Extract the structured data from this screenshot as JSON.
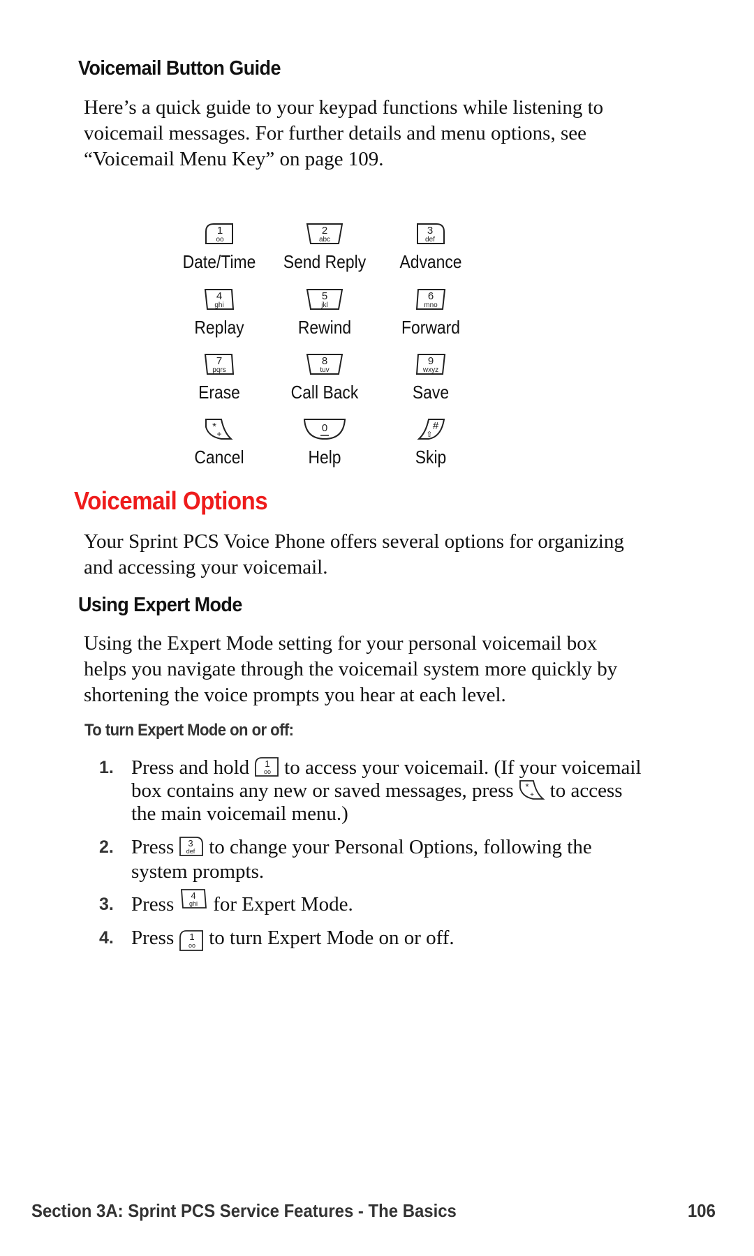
{
  "button_guide": {
    "heading": "Voicemail Button Guide",
    "intro_lines": [
      "Here’s a quick guide to your keypad functions while listening to",
      "voicemail messages. For further details and menu options, see",
      "“Voicemail Menu Key” on page 109."
    ],
    "keys": [
      {
        "digit": "1",
        "letters": "oo",
        "icon": "key-1-voicemail-icon",
        "label": "Date/Time"
      },
      {
        "digit": "2",
        "letters": "abc",
        "icon": "key-2-icon",
        "label": "Send Reply"
      },
      {
        "digit": "3",
        "letters": "def",
        "icon": "key-3-icon",
        "label": "Advance"
      },
      {
        "digit": "4",
        "letters": "ghi",
        "icon": "key-4-icon",
        "label": "Replay"
      },
      {
        "digit": "5",
        "letters": "jkl",
        "icon": "key-5-icon",
        "label": "Rewind"
      },
      {
        "digit": "6",
        "letters": "mno",
        "icon": "key-6-icon",
        "label": "Forward"
      },
      {
        "digit": "7",
        "letters": "pqrs",
        "icon": "key-7-icon",
        "label": "Erase"
      },
      {
        "digit": "8",
        "letters": "tuv",
        "icon": "key-8-icon",
        "label": "Call Back"
      },
      {
        "digit": "9",
        "letters": "wxyz",
        "icon": "key-9-icon",
        "label": "Save"
      },
      {
        "digit": "*",
        "letters": "+",
        "icon": "key-star-icon",
        "label": "Cancel"
      },
      {
        "digit": "0",
        "letters": "",
        "icon": "key-0-icon",
        "label": "Help"
      },
      {
        "digit": "#",
        "letters": "⇧",
        "icon": "key-pound-icon",
        "label": "Skip"
      }
    ]
  },
  "options": {
    "heading": "Voicemail Options",
    "heading_color": "#ee1c1c",
    "intro_lines": [
      "Your Sprint PCS Voice Phone offers several options for organizing",
      "and accessing your voicemail."
    ]
  },
  "expert_mode": {
    "heading": "Using Expert Mode",
    "intro_lines": [
      "Using the Expert Mode setting for your personal voicemail box",
      "helps you navigate through the voicemail system more quickly by",
      "shortening the voice prompts you hear at each level."
    ],
    "procedure_title": "To turn Expert Mode on or off:",
    "steps": [
      {
        "number": "1.",
        "line1_a": "Press and hold",
        "line1_b": "to access your voicemail. (If your voicemail",
        "line2_a": "box contains any new or saved messages, press",
        "line2_b": "to access",
        "line3": "the main voicemail menu.)"
      },
      {
        "number": "2.",
        "line1_a": "Press",
        "line1_b": "to change your Personal Options, following the",
        "line2": "system prompts."
      },
      {
        "number": "3.",
        "line1_a": "Press",
        "line1_b": "for Expert Mode."
      },
      {
        "number": "4.",
        "line1_a": "Press",
        "line1_b": "to turn Expert Mode on or off."
      }
    ]
  },
  "footer": {
    "section": "Section 3A: Sprint PCS Service Features - The Basics",
    "page_number": "106"
  }
}
